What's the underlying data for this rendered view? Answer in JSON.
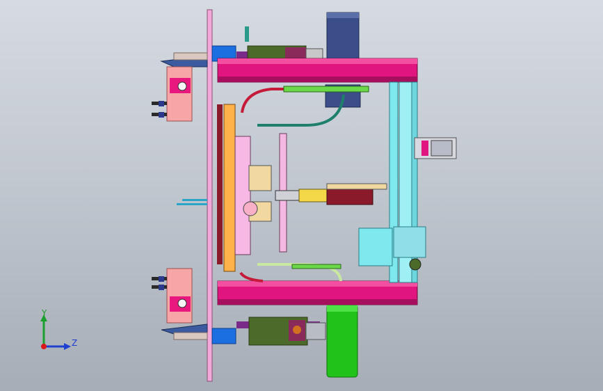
{
  "triad": {
    "y_label": "Y",
    "z_label": "Z"
  },
  "colors": {
    "background_top": "#d6dbe2",
    "background_bottom": "#a7adb6",
    "frame_magenta": "#e0157f",
    "rail_cyan": "#7fe7ee",
    "wheel_green": "#21c21a",
    "wheel_navy": "#3b4e8a",
    "cylinder_olive": "#4c6a2a",
    "plate_pink": "#f2a8d8",
    "motor_salmon": "#f7a6a6"
  }
}
